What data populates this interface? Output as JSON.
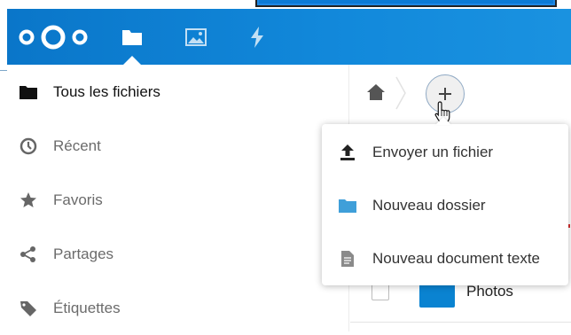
{
  "header": {
    "apps": [
      {
        "name": "Fichiers",
        "icon": "folder-icon",
        "active": true
      },
      {
        "name": "Photos",
        "icon": "image-icon",
        "active": false
      },
      {
        "name": "Activité",
        "icon": "lightning-icon",
        "active": false
      }
    ],
    "colors": {
      "header_bg": "#0a76c9",
      "accent": "#0082c9",
      "folder": "#0a83d1"
    }
  },
  "sidebar": {
    "items": [
      {
        "label": "Tous les fichiers",
        "icon": "folder-icon",
        "active": true
      },
      {
        "label": "Récent",
        "icon": "clock-icon",
        "active": false
      },
      {
        "label": "Favoris",
        "icon": "star-icon",
        "active": false
      },
      {
        "label": "Partages",
        "icon": "share-icon",
        "active": false
      },
      {
        "label": "Étiquettes",
        "icon": "tag-icon",
        "active": false
      }
    ]
  },
  "breadcrumb": {
    "home_icon": "home-icon",
    "add_button": "+"
  },
  "new_menu": {
    "items": [
      {
        "label": "Envoyer un fichier",
        "icon": "upload-icon"
      },
      {
        "label": "Nouveau dossier",
        "icon": "folder-icon"
      },
      {
        "label": "Nouveau document texte",
        "icon": "text-file-icon"
      }
    ]
  },
  "file_list": {
    "rows": [
      {
        "name": "Photos",
        "type": "folder"
      }
    ]
  }
}
